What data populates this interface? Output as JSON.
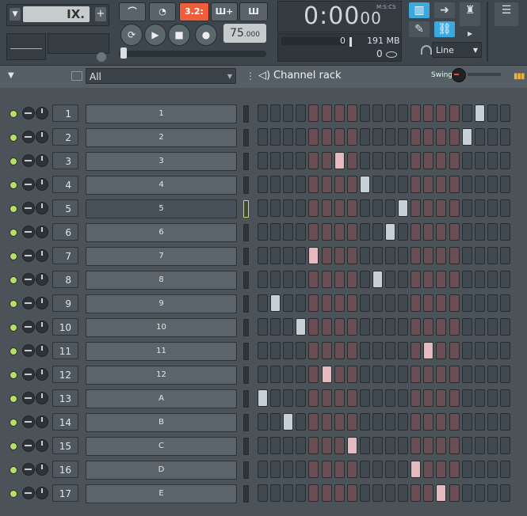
{
  "toolbar": {
    "pattern": {
      "name": "IX.",
      "add_label": "+"
    },
    "buttons": {
      "snap": "3.2:",
      "tempo_mode": "Ш+",
      "loop_mode": "Ш"
    },
    "tempo": {
      "value": "75",
      "decimal": ".000"
    },
    "time": {
      "display": "0:00",
      "fraction": "00",
      "label": "M:S:CS"
    },
    "meter": {
      "cpu": "0",
      "memory": "191 MB",
      "polyphony": "0"
    },
    "link_mode": "Line",
    "colors": {
      "accent_orange": "#f05d3a",
      "accent_blue": "#3aa9df",
      "led_green": "#b5e063"
    }
  },
  "rack": {
    "filter_value": "All",
    "title": "Channel rack",
    "swing_label": "Swing"
  },
  "channels": [
    {
      "num": "1",
      "name": "1",
      "selected": false,
      "on_step": 17
    },
    {
      "num": "2",
      "name": "2",
      "selected": false,
      "on_step": 16
    },
    {
      "num": "3",
      "name": "3",
      "selected": false,
      "on_step": 6
    },
    {
      "num": "4",
      "name": "4",
      "selected": false,
      "on_step": 8
    },
    {
      "num": "5",
      "name": "5",
      "selected": true,
      "on_step": 11
    },
    {
      "num": "6",
      "name": "6",
      "selected": false,
      "on_step": 10
    },
    {
      "num": "7",
      "name": "7",
      "selected": false,
      "on_step": 4
    },
    {
      "num": "8",
      "name": "8",
      "selected": false,
      "on_step": 9
    },
    {
      "num": "9",
      "name": "9",
      "selected": false,
      "on_step": 1
    },
    {
      "num": "10",
      "name": "10",
      "selected": false,
      "on_step": 3
    },
    {
      "num": "11",
      "name": "11",
      "selected": false,
      "on_step": 13
    },
    {
      "num": "12",
      "name": "12",
      "selected": false,
      "on_step": 5
    },
    {
      "num": "13",
      "name": "A",
      "selected": false,
      "on_step": 0
    },
    {
      "num": "14",
      "name": "B",
      "selected": false,
      "on_step": 2
    },
    {
      "num": "15",
      "name": "C",
      "selected": false,
      "on_step": 7
    },
    {
      "num": "16",
      "name": "D",
      "selected": false,
      "on_step": 12
    },
    {
      "num": "17",
      "name": "E",
      "selected": false,
      "on_step": 14
    }
  ]
}
